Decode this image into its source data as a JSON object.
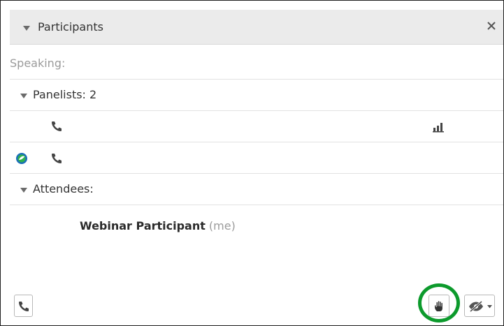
{
  "panel": {
    "title": "Participants",
    "speaking_label": "Speaking:"
  },
  "panelists": {
    "label": "Panelists: 2",
    "items": [
      {
        "icons": [
          "phone-icon",
          "signal-bars-icon"
        ]
      },
      {
        "icons": [
          "webex-app-icon",
          "phone-icon"
        ]
      }
    ]
  },
  "attendees": {
    "label": "Attendees:",
    "items": [
      {
        "name": "Webinar Participant",
        "suffix": "(me)"
      }
    ]
  },
  "toolbar": {
    "icons": [
      "phone-icon",
      "raise-hand-icon",
      "hide-video-icon"
    ]
  },
  "colors": {
    "header_bg": "#ebebeb",
    "highlight_ring": "#0c9a2c",
    "muted_text": "#9b9b9b"
  }
}
